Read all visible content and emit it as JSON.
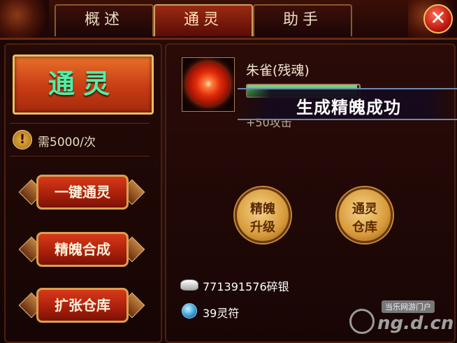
{
  "tabs": [
    {
      "label": "概述",
      "active": false
    },
    {
      "label": "通灵",
      "active": true
    },
    {
      "label": "助手",
      "active": false
    }
  ],
  "close_label": "✕",
  "left": {
    "main_button": "通灵",
    "cost_icon": "!",
    "cost_text": "需5000/次",
    "actions": [
      "一键通灵",
      "精魄合成",
      "扩张仓库"
    ]
  },
  "pet": {
    "name": "朱雀(残魂)",
    "xp_fraction": 0.98,
    "stat": "+50攻击"
  },
  "toast": "生成精魄成功",
  "round_buttons": [
    {
      "line1": "精魄",
      "line2": "升级"
    },
    {
      "line1": "通灵",
      "line2": "仓库"
    }
  ],
  "resources": {
    "silver": "771391576碎银",
    "talisman": "39灵符"
  },
  "watermark": {
    "tag": "当乐网游门户",
    "url": "ng.d.cn"
  },
  "colors": {
    "main_button_text": "#4ef0a8",
    "xp_bar": "#2a8a30",
    "active_tab": "#9a2a12"
  }
}
